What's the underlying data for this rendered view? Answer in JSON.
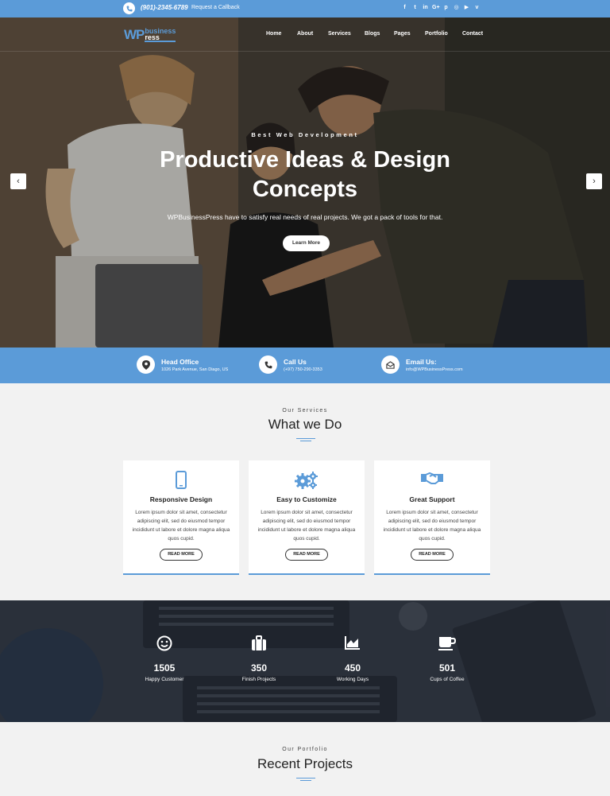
{
  "topbar": {
    "phone": "(901)-2345-6789",
    "callback": "Request a Callback",
    "social_icons": [
      "facebook-icon",
      "twitter-icon",
      "linkedin-icon",
      "google-plus-icon",
      "pinterest-icon",
      "instagram-icon",
      "youtube-icon",
      "vimeo-icon"
    ],
    "social_glyphs": [
      "f",
      "t",
      "in",
      "G+",
      "p",
      "◎",
      "▶",
      "v"
    ]
  },
  "header": {
    "logo_wp": "WP",
    "logo_business": "business",
    "logo_press": "ress",
    "menu": [
      "Home",
      "About",
      "Services",
      "Blogs",
      "Pages",
      "Portfolio",
      "Contact"
    ]
  },
  "hero": {
    "kicker": "Best Web Development",
    "title": "Productive Ideas & Design Concepts",
    "subtitle": "WPBusinessPress have to satisfy real needs of real projects. We got a pack of tools for that.",
    "button": "Learn More",
    "prev": "‹",
    "next": "›"
  },
  "info": [
    {
      "title": "Head Office",
      "detail": "1026 Park Avenue, San Diago, US",
      "icon": "location-pin-icon"
    },
    {
      "title": "Call Us",
      "detail": "(+97) 750-290-3353",
      "icon": "phone-icon"
    },
    {
      "title": "Email Us:",
      "detail": "info@WPBusinessPress.com",
      "icon": "envelope-icon"
    }
  ],
  "services": {
    "kicker": "Our Services",
    "title": "What we Do",
    "cards": [
      {
        "title": "Responsive Design",
        "text": "Lorem ipsum dolor sit amet, consectetur adipiscing elit, sed do eiusmod tempor incididunt ut labore et dolore magna aliqua quos cupid.",
        "button": "READ MORE",
        "icon": "mobile-phone-icon"
      },
      {
        "title": "Easy to Customize",
        "text": "Lorem ipsum dolor sit amet, consectetur adipiscing elit, sed do eiusmod tempor incididunt ut labore et dolore magna aliqua quos cupid.",
        "button": "READ MORE",
        "icon": "gears-icon"
      },
      {
        "title": "Great Support",
        "text": "Lorem ipsum dolor sit amet, consectetur adipiscing elit, sed do eiusmod tempor incididunt ut labore et dolore magna aliqua quos cupid.",
        "button": "READ MORE",
        "icon": "handshake-icon"
      }
    ]
  },
  "counters": [
    {
      "value": "1505",
      "label": "Happy Customer",
      "icon": "smiley-icon"
    },
    {
      "value": "350",
      "label": "Finish Projects",
      "icon": "briefcase-icon"
    },
    {
      "value": "450",
      "label": "Working Days",
      "icon": "area-chart-icon"
    },
    {
      "value": "501",
      "label": "Cups of Coffee",
      "icon": "coffee-cup-icon"
    }
  ],
  "portfolio": {
    "kicker": "Our Portfolio",
    "title": "Recent Projects"
  },
  "colors": {
    "accent": "#5b9bd8",
    "dark": "#2e333d"
  }
}
